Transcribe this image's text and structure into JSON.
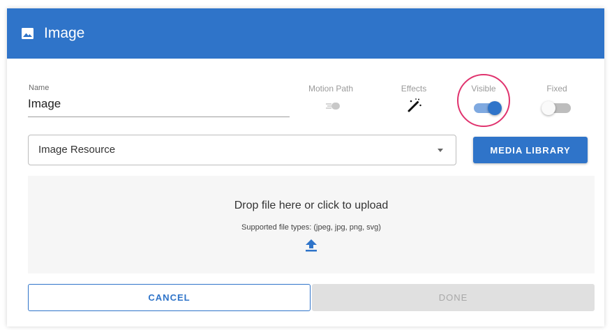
{
  "header": {
    "title": "Image",
    "icon": "image-icon",
    "color": "#2f74c9"
  },
  "name_field": {
    "label": "Name",
    "value": "Image"
  },
  "options": {
    "motion_path": {
      "label": "Motion Path",
      "icon": "motion-path-icon"
    },
    "effects": {
      "label": "Effects",
      "icon": "magic-wand-icon"
    },
    "visible": {
      "label": "Visible",
      "on": true
    },
    "fixed": {
      "label": "Fixed",
      "on": false
    }
  },
  "resource_select": {
    "value": "Image Resource",
    "icon": "chevron-down-icon"
  },
  "media_library_button": {
    "label": "MEDIA LIBRARY"
  },
  "dropzone": {
    "title": "Drop file here or click to upload",
    "subtitle": "Supported file types: (jpeg, jpg, png, svg)",
    "icon": "upload-icon"
  },
  "footer": {
    "cancel_label": "CANCEL",
    "done_label": "DONE"
  },
  "colors": {
    "accent": "#2f74c9",
    "highlight": "#e0336e",
    "disabled": "#e0e0e0"
  }
}
